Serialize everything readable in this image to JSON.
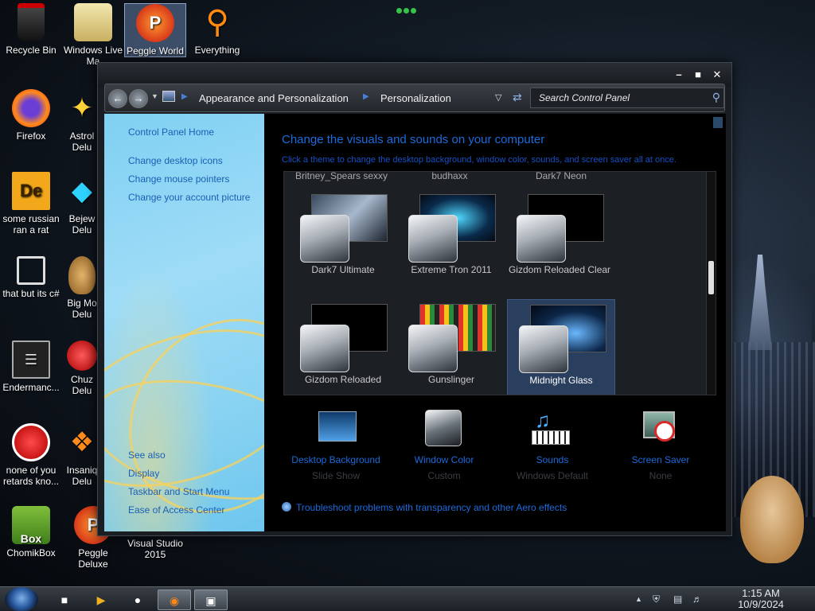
{
  "desktop": {
    "icons": [
      {
        "label": "Recycle Bin",
        "glyph": "trash-icon"
      },
      {
        "label": "Windows Live Ma",
        "glyph": "mail-icon"
      },
      {
        "label": "Peggle World",
        "glyph": "peggle-icon"
      },
      {
        "label": "Everything",
        "glyph": "magnifier-icon"
      },
      {
        "label": "Firefox",
        "glyph": "firefox-icon"
      },
      {
        "label": "Astrol Delu",
        "glyph": "star-icon"
      },
      {
        "label": "some russian ran a rat",
        "glyph": "de-icon"
      },
      {
        "label": "Bejew Delu",
        "glyph": "gem-icon"
      },
      {
        "label": "that but its c#",
        "glyph": "copy-icon"
      },
      {
        "label": "Big Mo Delu",
        "glyph": "moneybag-icon"
      },
      {
        "label": "Endermanc...",
        "glyph": "terminal-icon"
      },
      {
        "label": "Chuz Delu",
        "glyph": "creature-icon"
      },
      {
        "label": "none of you retards kno...",
        "glyph": "dragon-icon"
      },
      {
        "label": "Insaniq Delu",
        "glyph": "fish-icon"
      },
      {
        "label": "ChomikBox",
        "glyph": "box-icon"
      },
      {
        "label": "Peggle Deluxe",
        "glyph": "peggle-icon"
      },
      {
        "label": "Visual Studio 2015",
        "glyph": "vs-icon"
      }
    ],
    "Dе_glyph": "De",
    "box_glyph": "Box"
  },
  "window": {
    "breadcrumb": [
      "Appearance and Personalization",
      "Personalization"
    ],
    "search_placeholder": "Search Control Panel",
    "sidebar": {
      "home": "Control Panel Home",
      "links": [
        "Change desktop icons",
        "Change mouse pointers",
        "Change your account picture"
      ],
      "see_also_title": "See also",
      "see_also": [
        "Display",
        "Taskbar and Start Menu",
        "Ease of Access Center"
      ]
    },
    "heading": "Change the visuals and sounds on your computer",
    "subheading": "Click a theme to change the desktop background, window color, sounds, and screen saver all at once.",
    "top_row_labels": [
      "Britney_Spears sexxy",
      "budhaxx",
      "Dark7 Neon"
    ],
    "themes": [
      {
        "name": "Dark7 Ultimate",
        "selected": false
      },
      {
        "name": "Extreme Tron 2011",
        "selected": false
      },
      {
        "name": "Gizdom Reloaded Clear",
        "selected": false
      },
      {
        "name": "Gizdom Reloaded",
        "selected": false
      },
      {
        "name": "Gunslinger",
        "selected": false
      },
      {
        "name": "Midnight Glass",
        "selected": true
      }
    ],
    "settings": [
      {
        "name": "Desktop Background",
        "value": "Slide Show"
      },
      {
        "name": "Window Color",
        "value": "Custom"
      },
      {
        "name": "Sounds",
        "value": "Windows Default"
      },
      {
        "name": "Screen Saver",
        "value": "None"
      }
    ],
    "troubleshoot": "Troubleshoot problems with transparency and other Aero effects"
  },
  "taskbar": {
    "time": "1:15 AM",
    "date": "10/9/2024"
  }
}
